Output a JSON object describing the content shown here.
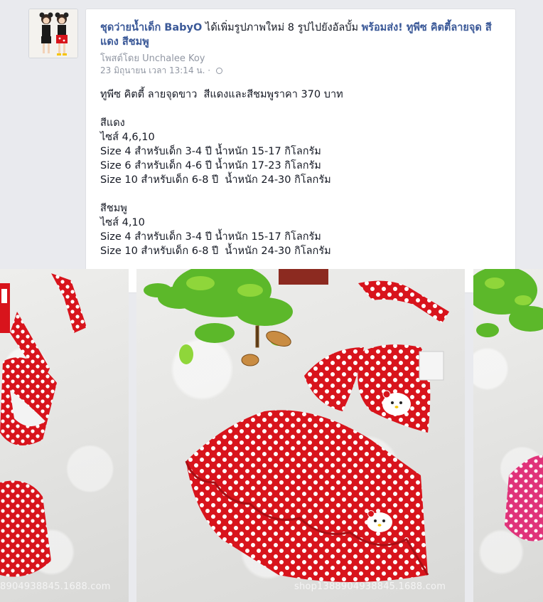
{
  "post": {
    "page_name": "ชุดว่ายน้ำเด็ก BabyO",
    "action_text": " ได้เพิ่มรูปภาพใหม่ 8 รูปไปยังอัลบั้ม ",
    "album_name": "พร้อมส่ง! ทูพีซ คิตตี้ลายจุด สีแดง สีชมพู",
    "posted_by": "โพสต์โดย Unchalee Koy",
    "timestamp": "23 มิถุนายน เวลา 13:14 น.",
    "separator": "·",
    "body": [
      "ทูพีซ คิตตี้ ลายจุดขาว  สีแดงและสีชมพูราคา 370 บาท",
      "สีแดง",
      "ไซส์ 4,6,10",
      "Size 4 สำหรับเด็ก 3-4 ปี น้ำหนัก 15-17 กิโลกรัม",
      "Size 6 สำหรับเด็ก 4-6 ปี น้ำหนัก 17-23 กิโลกรัม",
      "Size 10 สำหรับเด็ก 6-8 ปี  น้ำหนัก 24-30 กิโลกรัม",
      "สีชมพู",
      "ไซส์ 4,10",
      "Size 4 สำหรับเด็ก 3-4 ปี น้ำหนัก 15-17 กิโลกรัม",
      "Size 10 สำหรับเด็ก 6-8 ปี  น้ำหนัก 24-30 กิโลกรัม"
    ]
  },
  "photos": {
    "left_watermark": "8904938845.1688.com",
    "center_watermark": "shop1388904938845.1688.com"
  },
  "colors": {
    "link": "#3b5998",
    "meta": "#9197a3",
    "swimsuit_red": "#d8141c",
    "swimsuit_pink": "#e0337a"
  },
  "icons": [
    "globe-icon"
  ]
}
